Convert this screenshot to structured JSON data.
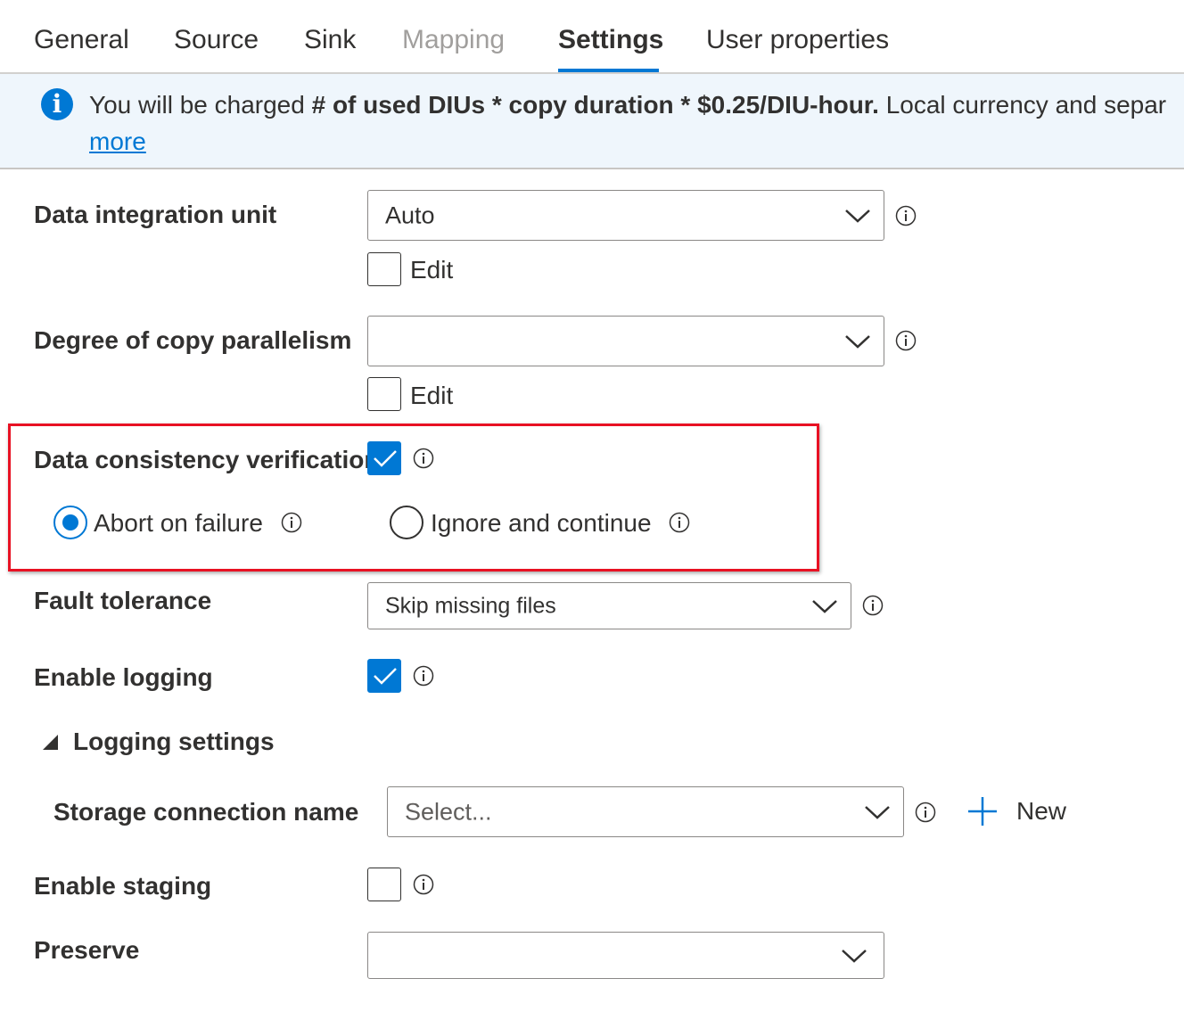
{
  "tabs": [
    {
      "label": "General",
      "state": "normal"
    },
    {
      "label": "Source",
      "state": "normal"
    },
    {
      "label": "Sink",
      "state": "normal"
    },
    {
      "label": "Mapping",
      "state": "disabled"
    },
    {
      "label": "Settings",
      "state": "active"
    },
    {
      "label": "User properties",
      "state": "normal"
    }
  ],
  "banner": {
    "icon": "info-icon",
    "text_prefix": "You will be charged ",
    "text_bold": "# of used DIUs * copy duration * $0.25/DIU-hour.",
    "text_suffix": " Local currency and separ",
    "link_text": "more"
  },
  "diu": {
    "label": "Data integration unit",
    "value": "Auto",
    "edit_label": "Edit",
    "edit_checked": false
  },
  "parallelism": {
    "label": "Degree of copy parallelism",
    "value": "",
    "edit_label": "Edit",
    "edit_checked": false
  },
  "consistency": {
    "label": "Data consistency verification",
    "checked": true,
    "options": [
      {
        "label": "Abort on failure",
        "selected": true
      },
      {
        "label": "Ignore and continue",
        "selected": false
      }
    ]
  },
  "fault_tolerance": {
    "label": "Fault tolerance",
    "value": "Skip missing files"
  },
  "logging": {
    "label": "Enable logging",
    "checked": true,
    "section_label": "Logging settings",
    "storage_label": "Storage connection name",
    "storage_placeholder": "Select...",
    "new_label": "New"
  },
  "staging": {
    "label": "Enable staging",
    "checked": false
  },
  "preserve": {
    "label": "Preserve",
    "value": ""
  },
  "colors": {
    "accent": "#0078d4",
    "highlight_border": "#e81123",
    "banner_bg": "#eff6fc"
  }
}
